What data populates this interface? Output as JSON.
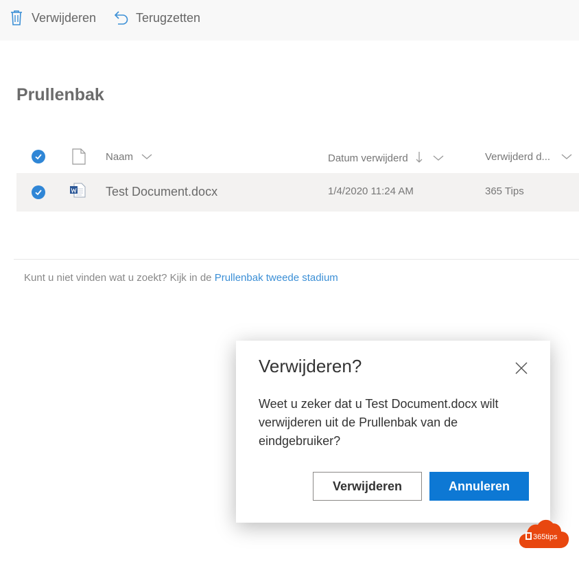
{
  "commandbar": {
    "delete_label": "Verwijderen",
    "restore_label": "Terugzetten"
  },
  "page": {
    "title": "Prullenbak"
  },
  "list": {
    "columns": {
      "name": "Naam",
      "date_deleted": "Datum verwijderd",
      "deleted_by": "Verwijderd d..."
    },
    "rows": [
      {
        "name": "Test Document.docx",
        "date_deleted": "1/4/2020 11:24 AM",
        "deleted_by": "365 Tips",
        "icon": "word-doc-icon",
        "selected": true
      }
    ]
  },
  "hint": {
    "text": "Kunt u niet vinden wat u zoekt? Kijk in de",
    "link": "Prullenbak tweede stadium"
  },
  "dialog": {
    "title": "Verwijderen?",
    "message": "Weet u zeker dat u Test Document.docx wilt verwijderen uit de Prullenbak van de eindgebruiker?",
    "confirm_label": "Verwijderen",
    "cancel_label": "Annuleren"
  },
  "watermark": {
    "text": "365tips"
  },
  "colors": {
    "accent": "#0d78d4",
    "check": "#2f86d6",
    "link": "#3b8fd6",
    "row_selected": "#f3f2f1",
    "logo": "#e8470f"
  }
}
